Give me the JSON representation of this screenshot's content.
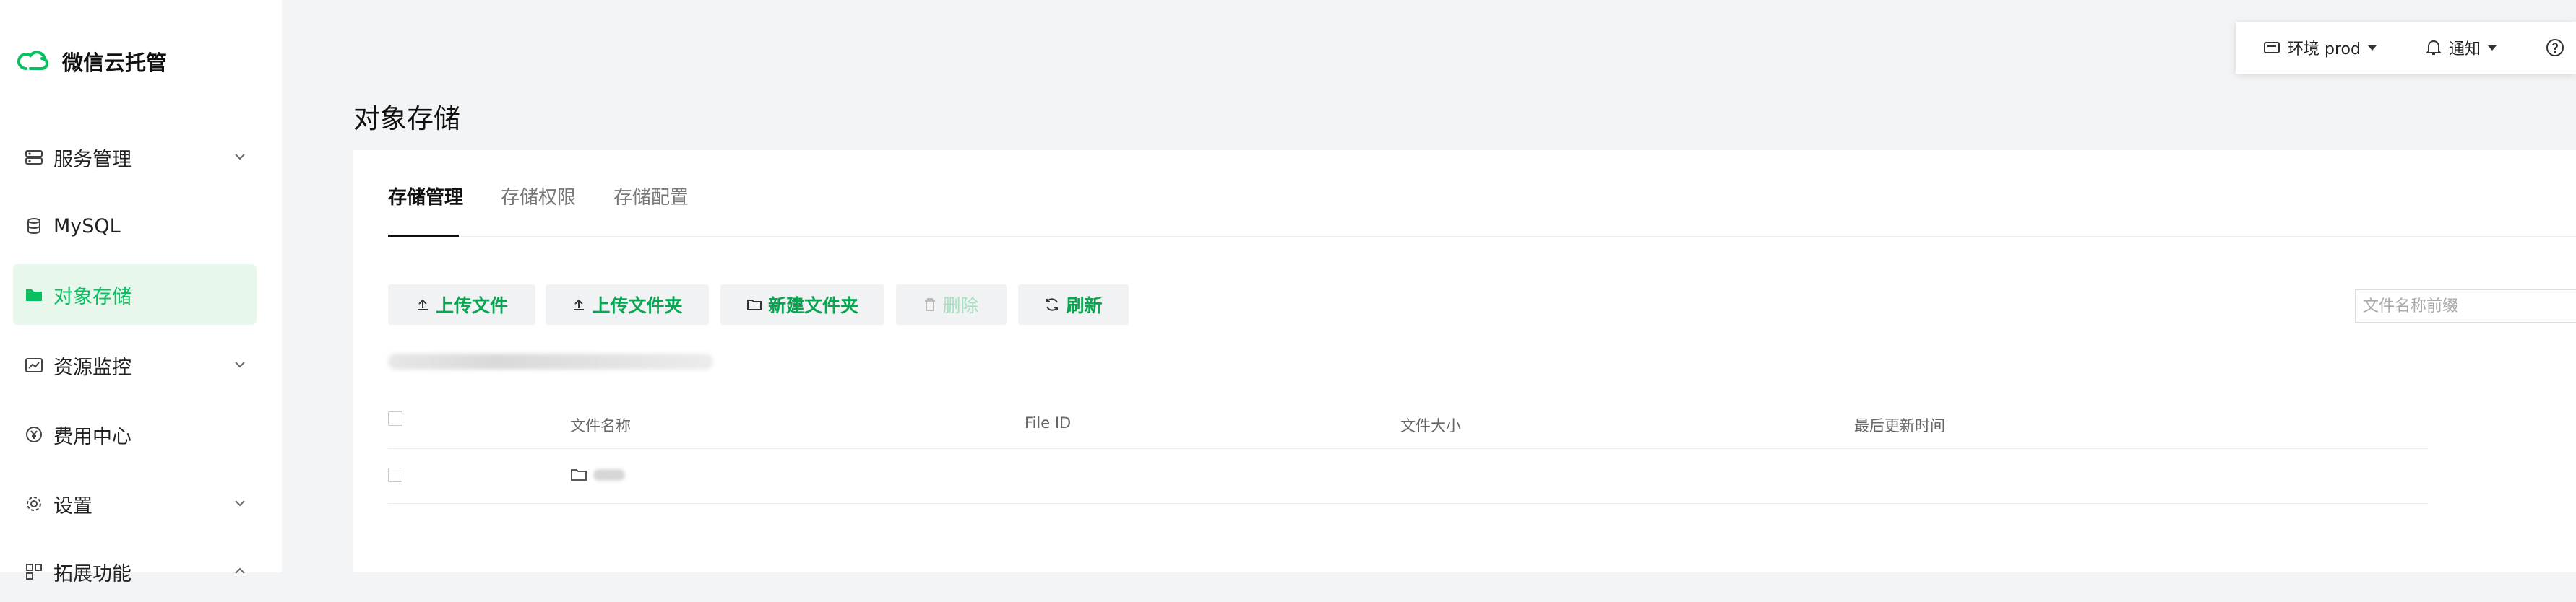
{
  "app": {
    "name": "微信云托管"
  },
  "sidebar": {
    "items": [
      {
        "label": "服务管理",
        "icon": "services-icon",
        "has_chevron": true
      },
      {
        "label": "MySQL",
        "icon": "database-icon",
        "has_chevron": false
      },
      {
        "label": "对象存储",
        "icon": "folder-icon",
        "has_chevron": false,
        "active": true
      },
      {
        "label": "资源监控",
        "icon": "monitor-icon",
        "has_chevron": true
      },
      {
        "label": "费用中心",
        "icon": "yen-icon",
        "has_chevron": false
      },
      {
        "label": "设置",
        "icon": "gear-icon",
        "has_chevron": true
      },
      {
        "label": "拓展功能",
        "icon": "extension-icon",
        "has_chevron": true
      }
    ]
  },
  "header": {
    "env_label": "环境 prod",
    "notify_label": "通知"
  },
  "page": {
    "title": "对象存储"
  },
  "tabs": [
    {
      "label": "存储管理",
      "active": true
    },
    {
      "label": "存储权限",
      "active": false
    },
    {
      "label": "存储配置",
      "active": false
    }
  ],
  "toolbar": {
    "upload_file": "上传文件",
    "upload_folder": "上传文件夹",
    "new_folder": "新建文件夹",
    "delete": "删除",
    "refresh": "刷新",
    "search_placeholder": "文件名称前缀"
  },
  "table": {
    "columns": [
      "文件名称",
      "File ID",
      "文件大小",
      "最后更新时间"
    ]
  },
  "colors": {
    "accent": "#07c160",
    "active_bg": "#e7f7ec",
    "page_bg": "#f3f4f6"
  }
}
